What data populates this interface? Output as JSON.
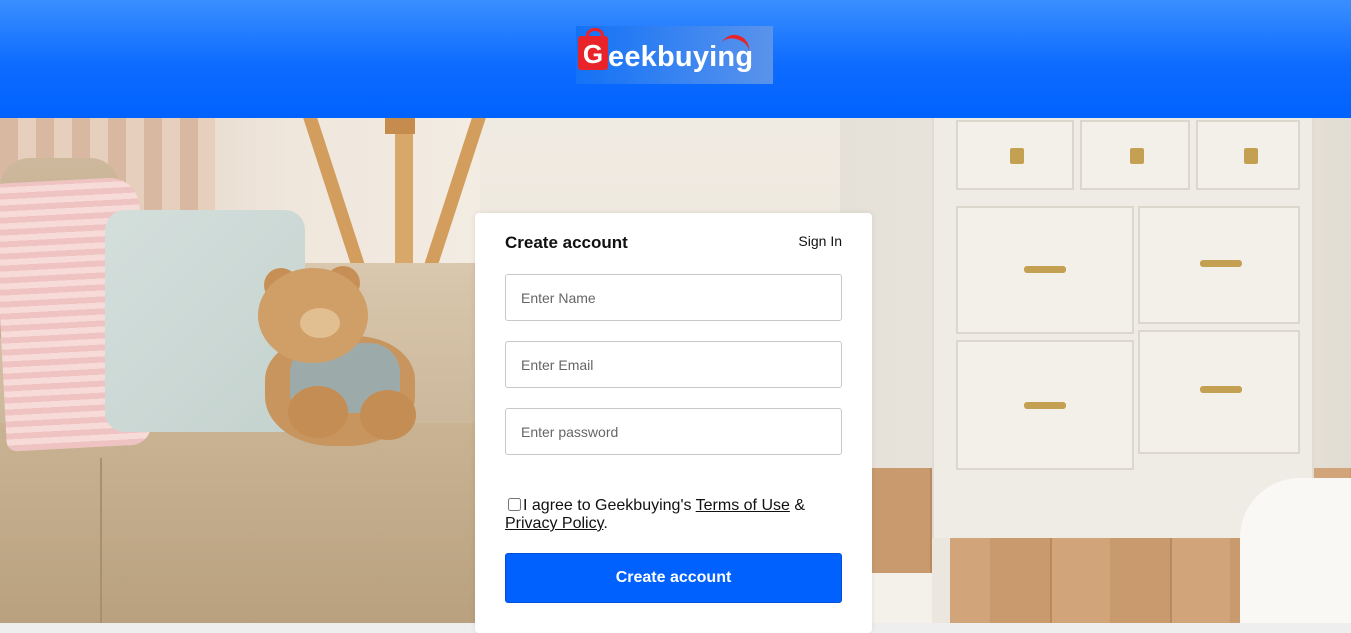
{
  "header": {
    "logo_text": "Geekbuying",
    "logo_alt": "Geekbuying logo",
    "brand_color": "#0062ff",
    "logo_accent": "#e8232a"
  },
  "form": {
    "title": "Create account",
    "sign_in_label": "Sign In",
    "name_placeholder": "Enter Name",
    "email_placeholder": "Enter Email",
    "password_placeholder": "Enter password",
    "agree_prefix": "I agree to Geekbuying's ",
    "terms_label": "Terms of Use",
    "agree_joiner": " & ",
    "privacy_label": "Privacy Policy",
    "agree_suffix": ".",
    "submit_label": "Create account",
    "button_color": "#0061ff",
    "agree_checked": false
  }
}
